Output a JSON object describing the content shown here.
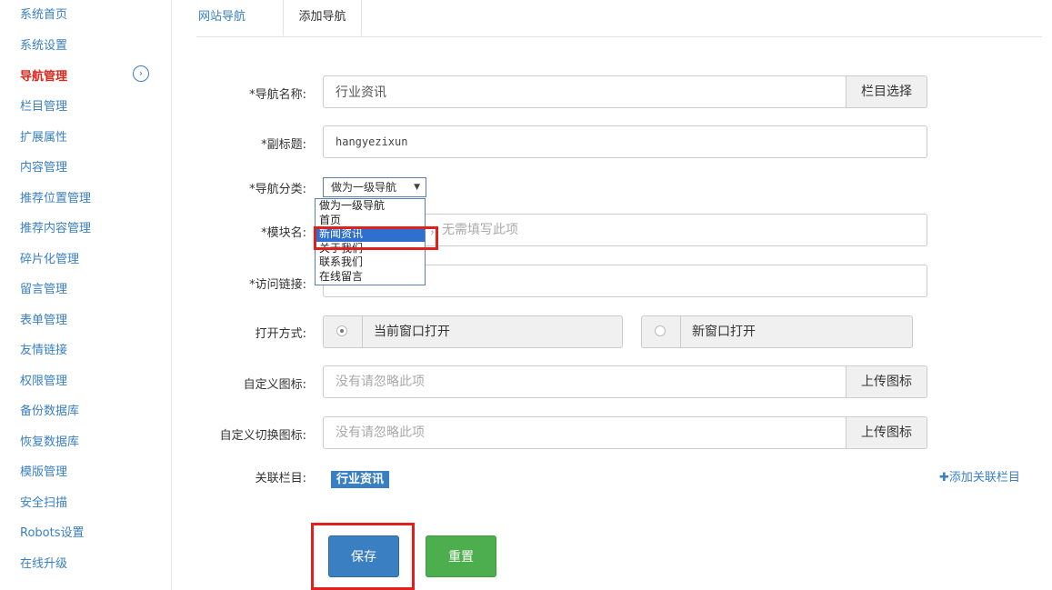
{
  "sidebar": {
    "items": [
      {
        "label": "系统首页"
      },
      {
        "label": "系统设置"
      },
      {
        "label": "导航管理",
        "active": true
      },
      {
        "label": "栏目管理"
      },
      {
        "label": "扩展属性"
      },
      {
        "label": "内容管理"
      },
      {
        "label": "推荐位置管理"
      },
      {
        "label": "推荐内容管理"
      },
      {
        "label": "碎片化管理"
      },
      {
        "label": "留言管理"
      },
      {
        "label": "表单管理"
      },
      {
        "label": "友情链接"
      },
      {
        "label": "权限管理"
      },
      {
        "label": "备份数据库"
      },
      {
        "label": "恢复数据库"
      },
      {
        "label": "模版管理"
      },
      {
        "label": "安全扫描"
      },
      {
        "label": "Robots设置"
      },
      {
        "label": "在线升级"
      }
    ],
    "toggle_icon": "chevron-right-circle-icon"
  },
  "tabs": [
    {
      "label": "网站导航"
    },
    {
      "label": "添加导航",
      "active": true
    }
  ],
  "form": {
    "nav_name": {
      "label": "*导航名称:",
      "value": "行业资讯",
      "addon": "栏目选择"
    },
    "subtitle": {
      "label": "*副标题:",
      "value": "hangyezixun"
    },
    "nav_category": {
      "label": "*导航分类:",
      "selected": "做为一级导航",
      "options": [
        "做为一级导航",
        "首页",
        "新闻资讯",
        "关于我们",
        "联系我们",
        "在线留言"
      ],
      "highlighted_option": "新闻资讯"
    },
    "module_name": {
      "label": "*模块名:",
      "placeholder_visible": "无需填写此项"
    },
    "access_link": {
      "label": "*访问链接:"
    },
    "open_mode": {
      "label": "打开方式:",
      "options": [
        {
          "label": "当前窗口打开",
          "checked": true
        },
        {
          "label": "新窗口打开",
          "checked": false
        }
      ]
    },
    "custom_icon": {
      "label": "自定义图标:",
      "placeholder": "没有请忽略此项",
      "addon": "上传图标"
    },
    "custom_switch_icon": {
      "label": "自定义切换图标:",
      "placeholder": "没有请忽略此项",
      "addon": "上传图标"
    },
    "related_column": {
      "label": "关联栏目:",
      "tag": "行业资讯",
      "add_link": "✚添加关联栏目"
    }
  },
  "buttons": {
    "save": "保存",
    "reset": "重置"
  },
  "colors": {
    "accent": "#3a7fc1",
    "active": "#e0251b",
    "save": "#3a7fc1",
    "reset": "#4cae4c",
    "highlight": "#e0201c"
  }
}
